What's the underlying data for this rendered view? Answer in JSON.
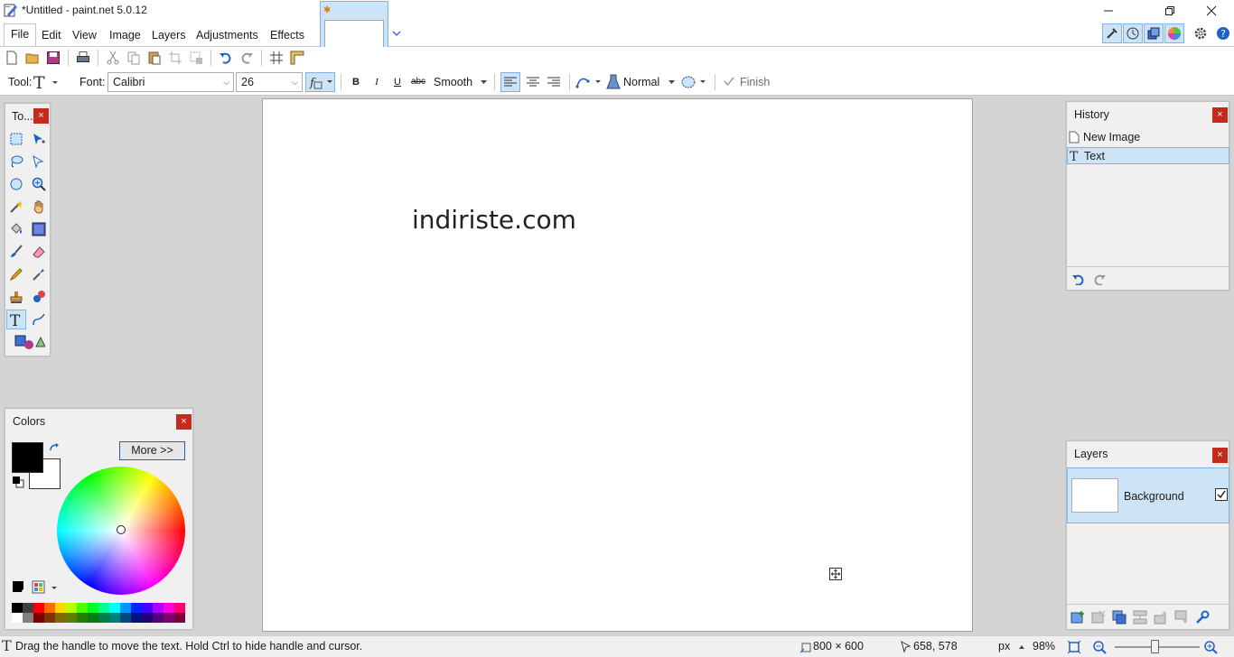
{
  "app": {
    "title": "*Untitled - paint.net 5.0.12"
  },
  "menu": {
    "items": [
      "File",
      "Edit",
      "View",
      "Image",
      "Layers",
      "Adjustments",
      "Effects"
    ]
  },
  "toolbar": {
    "tool_label": "Tool:",
    "font_label": "Font:",
    "font_value": "Calibri",
    "size_value": "26",
    "bold": "B",
    "italic": "I",
    "underline": "U",
    "strike": "abc",
    "antialias": "Smooth",
    "blend_mode": "Normal",
    "finish": "Finish"
  },
  "canvas": {
    "text": "indiriste.com"
  },
  "tools_panel": {
    "title": "To..."
  },
  "colors_panel": {
    "title": "Colors",
    "more_button": "More >>",
    "primary_color": "#000000",
    "secondary_color": "#ffffff",
    "palette_top": [
      "#000000",
      "#404040",
      "#ff0000",
      "#ff6a00",
      "#ffd800",
      "#b6ff00",
      "#4cff00",
      "#00ff21",
      "#00ff90",
      "#00ffff",
      "#0094ff",
      "#0026ff",
      "#4800ff",
      "#b200ff",
      "#ff00dc",
      "#ff006e"
    ],
    "palette_bottom": [
      "#ffffff",
      "#808080",
      "#7f0000",
      "#7f3300",
      "#7f6a00",
      "#5b7f00",
      "#267f00",
      "#007f0e",
      "#007f46",
      "#007f7f",
      "#004a7f",
      "#00137f",
      "#21007f",
      "#57007f",
      "#7f006e",
      "#7f0037"
    ]
  },
  "history_panel": {
    "title": "History",
    "items": [
      {
        "label": "New Image",
        "icon": "new-image-icon",
        "selected": false
      },
      {
        "label": "Text",
        "icon": "text-tool-icon",
        "selected": true
      }
    ]
  },
  "layers_panel": {
    "title": "Layers",
    "layers": [
      {
        "name": "Background",
        "visible": true,
        "selected": true
      }
    ]
  },
  "status": {
    "hint": "Drag the handle to move the text. Hold Ctrl to hide handle and cursor.",
    "image_size": "800 × 600",
    "cursor_pos": "658, 578",
    "units": "px",
    "zoom": "98%"
  },
  "colors": {
    "accent": "#7eb4ea",
    "selection": "#cde4f7",
    "close": "#c42b1c"
  }
}
